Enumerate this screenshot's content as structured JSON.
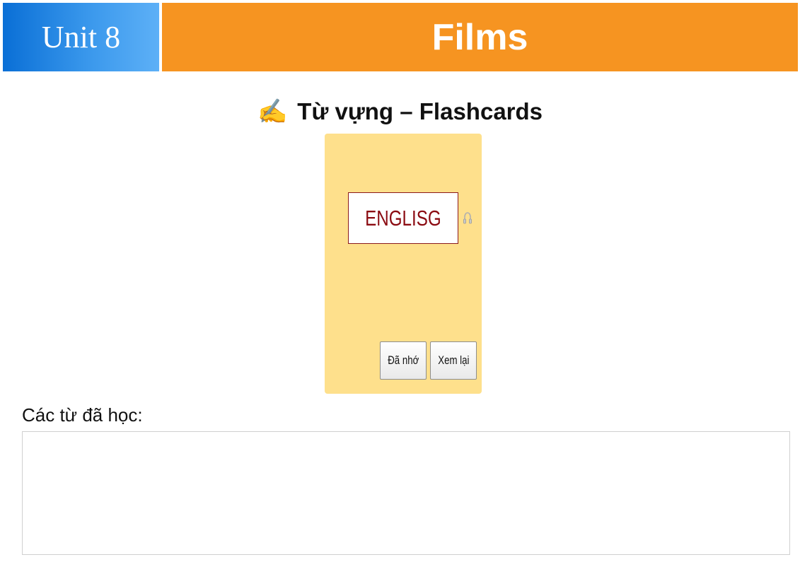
{
  "header": {
    "unit_label": "Unit 8",
    "title": "Films"
  },
  "section": {
    "icon": "writing-hand-icon",
    "icon_glyph": "✍",
    "heading": "Từ vựng – Flashcards"
  },
  "flashcard": {
    "word": "ENGLISG",
    "speaker_icon": "speaker-icon",
    "remember_label": "Đã nhớ",
    "review_label": "Xem lại"
  },
  "learned": {
    "label": "Các từ đã học:",
    "items": []
  },
  "colors": {
    "unit_blue": "#0a6fd6",
    "title_orange": "#f69421",
    "card_yellow": "#fee08c",
    "word_red": "#8b0b12"
  }
}
